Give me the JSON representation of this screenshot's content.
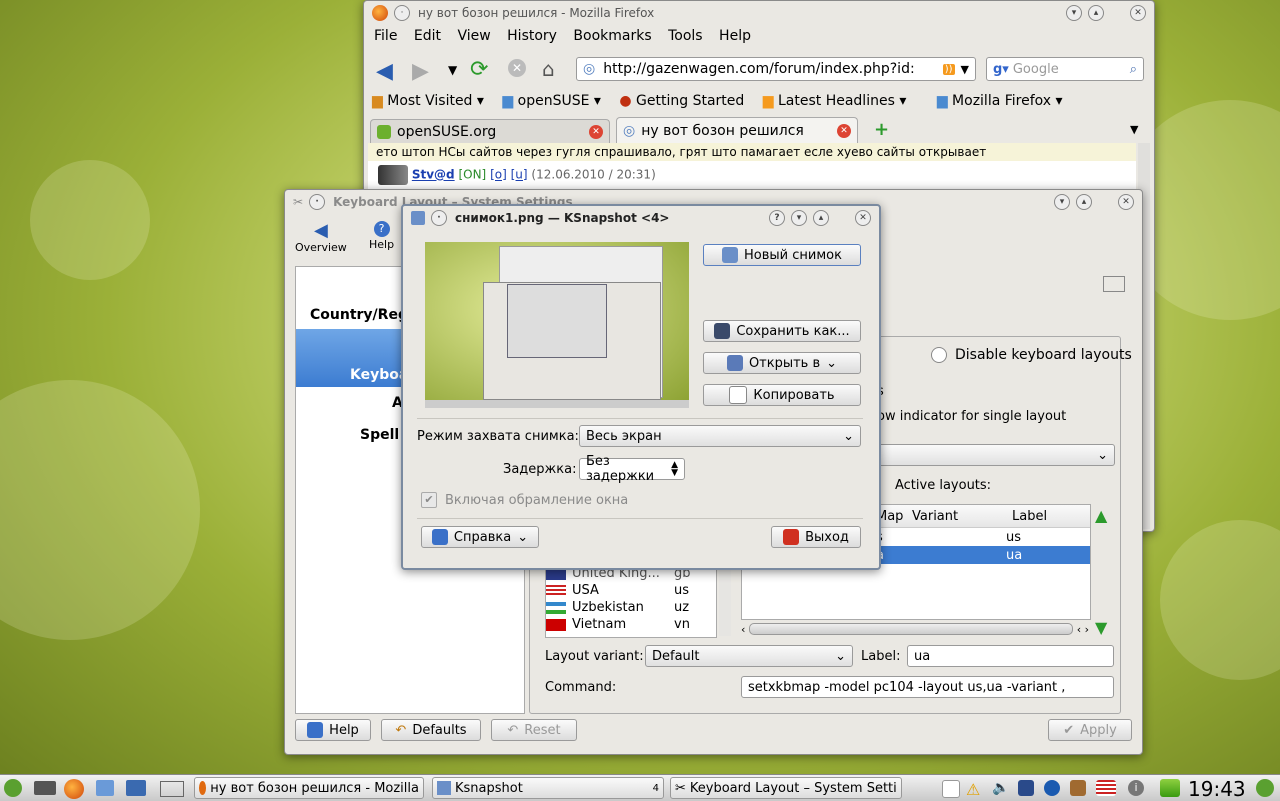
{
  "firefox": {
    "title": "ну вот бозон решился - Mozilla Firefox",
    "menu": [
      "File",
      "Edit",
      "View",
      "History",
      "Bookmarks",
      "Tools",
      "Help"
    ],
    "url": "http://gazenwagen.com/forum/index.php?id:",
    "search_placeholder": "Google",
    "bookmarks": [
      "Most Visited",
      "openSUSE",
      "Getting Started",
      "Latest Headlines",
      "Mozilla Firefox"
    ],
    "tabs": [
      "openSUSE.org",
      "ну вот бозон решился"
    ],
    "post_text": "ето штоп НСы сайтов через гугля спрашивало, грят што памагает есле хуево сайты открывает",
    "post_user": "Stv@d",
    "post_status": "[ON]",
    "post_links": [
      "[o]",
      "[u]"
    ],
    "post_date": "(12.06.2010 / 20:31)"
  },
  "settings": {
    "title": "Keyboard Layout – System Settings",
    "toolbar": [
      "Overview",
      "Help"
    ],
    "sidebar": [
      "Country/Regi",
      "Keyboa",
      "A",
      "Spell C"
    ],
    "disable_layouts": "Disable keyboard layouts",
    "indicator_text_partial": "s",
    "show_indicator": "ow indicator for single layout",
    "active_layouts_label": "Active layouts:",
    "active_headers": [
      "Map",
      "Variant",
      "Label"
    ],
    "active_rows": [
      {
        "map": "s",
        "variant": "",
        "label": "us"
      },
      {
        "map": "a",
        "variant": "",
        "label": "ua"
      }
    ],
    "available_rows": [
      {
        "name": "United King...",
        "code": "gb"
      },
      {
        "name": "USA",
        "code": "us"
      },
      {
        "name": "Uzbekistan",
        "code": "uz"
      },
      {
        "name": "Vietnam",
        "code": "vn"
      }
    ],
    "layout_variant_label": "Layout variant:",
    "layout_variant_value": "Default",
    "label_label": "Label:",
    "label_value": "ua",
    "command_label": "Command:",
    "command_value": "setxkbmap -model pc104 -layout us,ua -variant ,",
    "buttons": {
      "help": "Help",
      "defaults": "Defaults",
      "reset": "Reset",
      "apply": "Apply"
    }
  },
  "ksnapshot": {
    "title": "снимок1.png — KSnapshot <4>",
    "new_snapshot": "Новый снимок",
    "save_as": "Сохранить как...",
    "open_with": "Открыть в",
    "copy": "Копировать",
    "capture_mode_label": "Режим захвата снимка:",
    "capture_mode_value": "Весь экран",
    "delay_label": "Задержка:",
    "delay_value": "Без задержки",
    "include_decorations": "Включая обрамление окна",
    "help": "Справка",
    "quit": "Выход"
  },
  "taskbar": {
    "tasks": [
      "ну вот бозон решился - Mozilla",
      "Ksnapshot",
      "Keyboard Layout – System Setti"
    ],
    "ksnapshot_count": "4",
    "clock": "19:43"
  }
}
